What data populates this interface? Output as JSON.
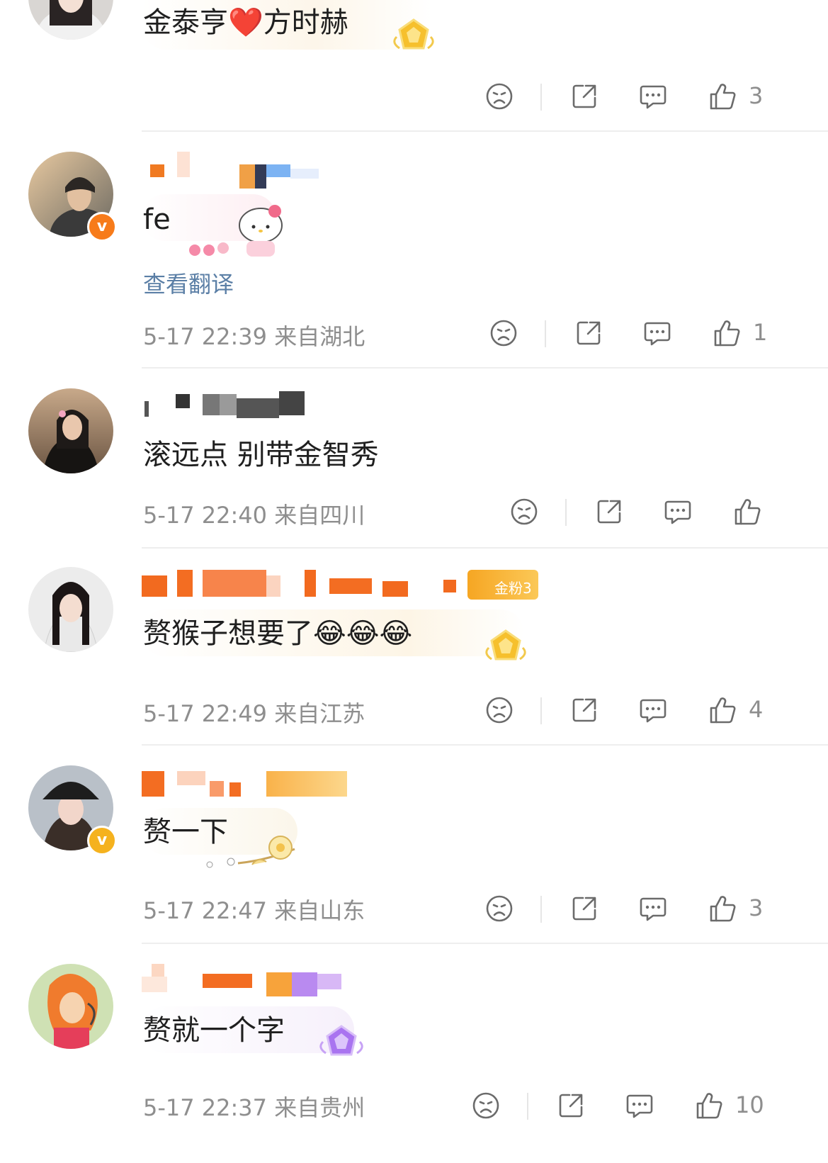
{
  "comments": [
    {
      "text": "金泰亨❤️方时赫",
      "meta": "",
      "like_count": "3",
      "translate": ""
    },
    {
      "text": "fe",
      "meta": "5-17 22:39 来自湖北",
      "like_count": "1",
      "translate": "查看翻译"
    },
    {
      "text": "滚远点 别带金智秀",
      "meta": "5-17 22:40 来自四川",
      "like_count": "",
      "translate": ""
    },
    {
      "text": "赘猴子想要了😂😂😂",
      "meta": "5-17 22:49 来自江苏",
      "like_count": "4",
      "translate": "",
      "fan_badge": "金粉3"
    },
    {
      "text": "赘一下",
      "meta": "5-17 22:47 来自山东",
      "like_count": "3",
      "translate": ""
    },
    {
      "text": "赘就一个字",
      "meta": "5-17 22:37 来自贵州",
      "like_count": "10",
      "translate": ""
    }
  ],
  "icons": {
    "dislike": "sad-face-icon",
    "share": "share-icon",
    "reply": "comment-bubble-icon",
    "like": "thumbs-up-icon"
  },
  "colors": {
    "link": "#5b7fa6",
    "meta": "#8e8e8e",
    "verified_orange": "#f77b1a",
    "verified_gold": "#f5b21e",
    "heart": "#e8202a"
  }
}
